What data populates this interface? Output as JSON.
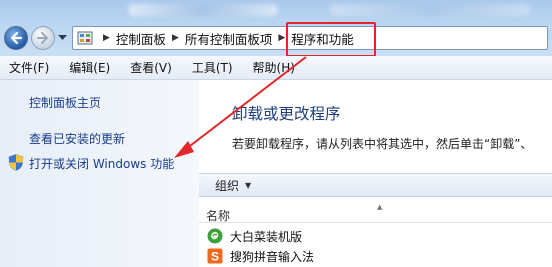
{
  "navigation": {
    "back_icon": "back-arrow-icon",
    "forward_icon": "forward-arrow-icon"
  },
  "address_bar": {
    "crumbs": [
      "控制面板",
      "所有控制面板项",
      "程序和功能"
    ]
  },
  "menu": {
    "items": [
      "文件(F)",
      "编辑(E)",
      "查看(V)",
      "工具(T)",
      "帮助(H)"
    ]
  },
  "sidebar": {
    "home": "控制面板主页",
    "updates": "查看已安装的更新",
    "features": "打开或关闭 Windows 功能"
  },
  "main": {
    "title": "卸载或更改程序",
    "description": "若要卸载程序，请从列表中将其选中，然后单击“卸载”、"
  },
  "toolbar": {
    "organize": "组织"
  },
  "table": {
    "name_header": "名称",
    "rows": [
      {
        "name": "大白菜装机版",
        "icon": "dabaicai-icon"
      },
      {
        "name": "搜狗拼音输入法",
        "icon": "sogou-icon"
      }
    ]
  },
  "colors": {
    "highlight": "#e2272a",
    "link": "#1a3c8c",
    "title": "#1f3f7a"
  }
}
